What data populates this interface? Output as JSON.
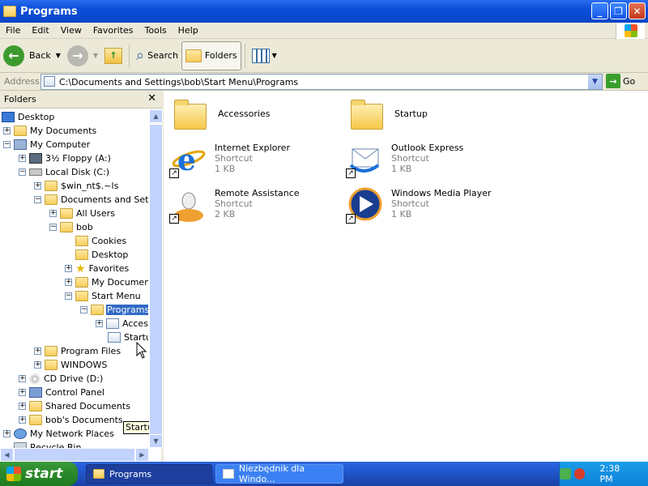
{
  "window": {
    "title": "Programs",
    "minimize": "_",
    "maximize": "❐",
    "close": "✕"
  },
  "menu": [
    "File",
    "Edit",
    "View",
    "Favorites",
    "Tools",
    "Help"
  ],
  "toolbar": {
    "back": "Back",
    "search": "Search",
    "folders": "Folders"
  },
  "address": {
    "label": "Address",
    "value": "C:\\Documents and Settings\\bob\\Start Menu\\Programs",
    "go": "Go"
  },
  "folders_pane": {
    "title": "Folders",
    "close": "✕",
    "tree": [
      {
        "label": "Desktop"
      },
      {
        "label": "My Documents"
      },
      {
        "label": "My Computer"
      },
      {
        "label": "3½ Floppy (A:)"
      },
      {
        "label": "Local Disk (C:)"
      },
      {
        "label": "$win_nt$.~ls"
      },
      {
        "label": "Documents and Settin"
      },
      {
        "label": "All Users"
      },
      {
        "label": "bob"
      },
      {
        "label": "Cookies"
      },
      {
        "label": "Desktop"
      },
      {
        "label": "Favorites"
      },
      {
        "label": "My Documents"
      },
      {
        "label": "Start Menu"
      },
      {
        "label": "Programs"
      },
      {
        "label": "Acces"
      },
      {
        "label": "Startup"
      },
      {
        "label": "Program Files"
      },
      {
        "label": "WINDOWS"
      },
      {
        "label": "CD Drive (D:)"
      },
      {
        "label": "Control Panel"
      },
      {
        "label": "Shared Documents"
      },
      {
        "label": "bob's Documents"
      },
      {
        "label": "My Network Places"
      },
      {
        "label": "Recycle Bin"
      }
    ],
    "tooltip": "Startup"
  },
  "content": {
    "items": [
      {
        "name": "Accessories",
        "type": "",
        "size": ""
      },
      {
        "name": "Startup",
        "type": "",
        "size": ""
      },
      {
        "name": "Internet Explorer",
        "type": "Shortcut",
        "size": "1 KB"
      },
      {
        "name": "Outlook Express",
        "type": "Shortcut",
        "size": "1 KB"
      },
      {
        "name": "Remote Assistance",
        "type": "Shortcut",
        "size": "2 KB"
      },
      {
        "name": "Windows Media Player",
        "type": "Shortcut",
        "size": "1 KB"
      }
    ]
  },
  "taskbar": {
    "start": "start",
    "tasks": [
      "Programs",
      "Niezbędnik dla Windo..."
    ],
    "clock": "2:38 PM"
  },
  "colors": {
    "title_blue": "#0a4ed8",
    "selection": "#316ac5",
    "start_green": "#2c8a2c",
    "tray_blue": "#0f83d8"
  }
}
